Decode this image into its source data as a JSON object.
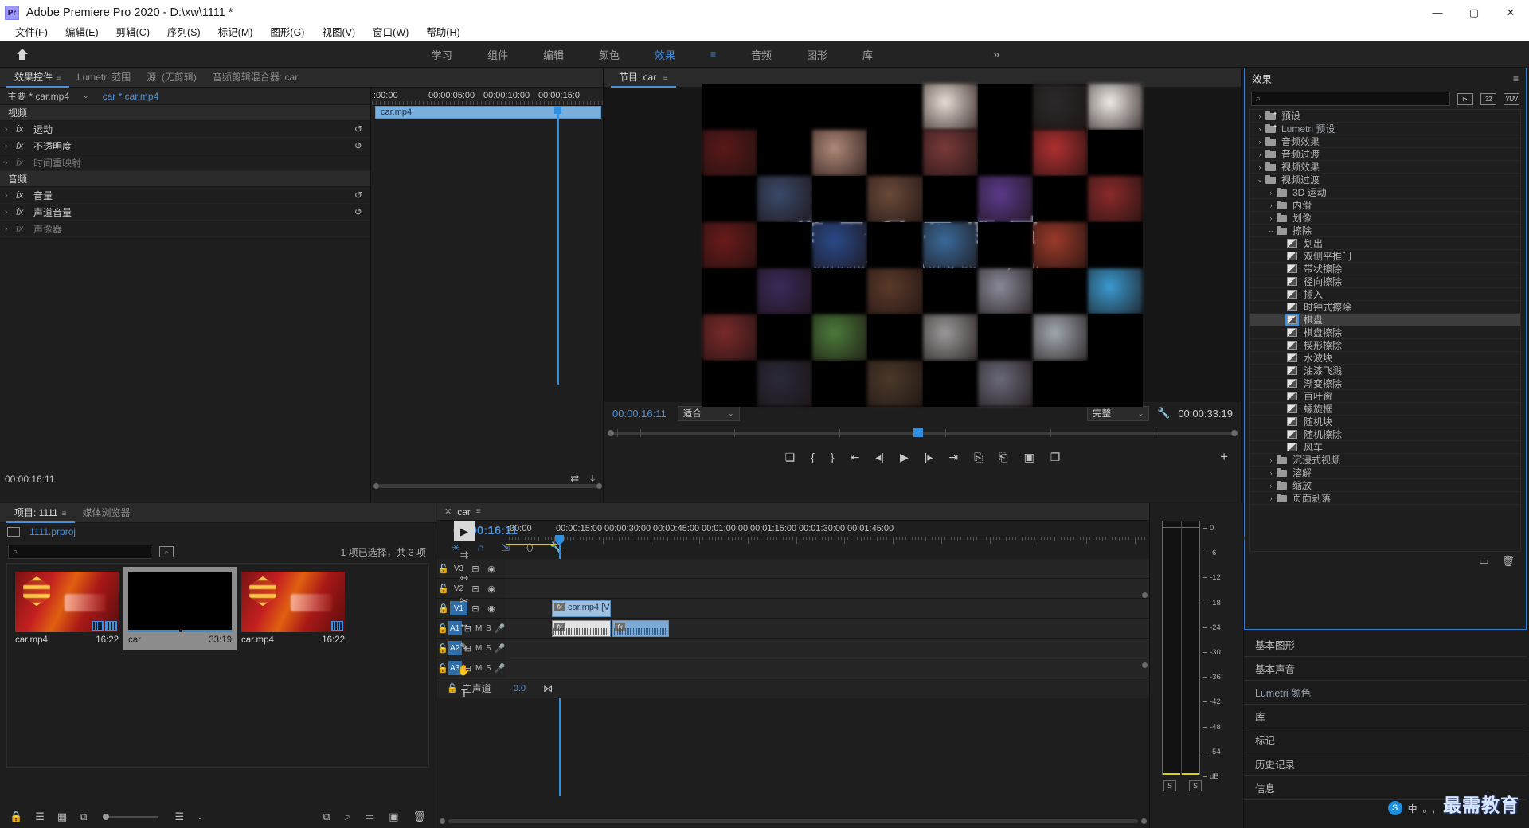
{
  "titlebar": {
    "logo": "Pr",
    "title": "Adobe Premiere Pro 2020 - D:\\xw\\1111 *",
    "minimize": "—",
    "maximize": "▢",
    "close": "✕"
  },
  "menubar": {
    "items": [
      "文件(F)",
      "编辑(E)",
      "剪辑(C)",
      "序列(S)",
      "标记(M)",
      "图形(G)",
      "视图(V)",
      "窗口(W)",
      "帮助(H)"
    ]
  },
  "workspace": {
    "home_icon": "home-icon",
    "items": [
      {
        "label": "学习",
        "active": false
      },
      {
        "label": "组件",
        "active": false
      },
      {
        "label": "编辑",
        "active": false
      },
      {
        "label": "颜色",
        "active": false
      },
      {
        "label": "效果",
        "active": true
      },
      {
        "label": "音频",
        "active": false
      },
      {
        "label": "图形",
        "active": false
      },
      {
        "label": "库",
        "active": false
      }
    ],
    "overflow": "»"
  },
  "effect_controls": {
    "tabs": [
      {
        "label": "效果控件",
        "active": true,
        "menu": "≡"
      },
      {
        "label": "Lumetri 范围",
        "active": false
      },
      {
        "label": "源: (无剪辑)",
        "active": false
      },
      {
        "label": "音频剪辑混合器: car",
        "active": false
      }
    ],
    "clip_bar": {
      "main": "主要 * car.mp4",
      "caret": "⌄",
      "sequence": "car * car.mp4"
    },
    "groups": [
      {
        "title": "视频",
        "rows": [
          {
            "arrow": "›",
            "fx": "fx",
            "name": "运动",
            "dim": false,
            "reset": "↺"
          },
          {
            "arrow": "›",
            "fx": "fx",
            "name": "不透明度",
            "dim": false,
            "reset": "↺"
          },
          {
            "arrow": "›",
            "fx": "fx",
            "name": "时间重映射",
            "dim": true,
            "reset": ""
          }
        ]
      },
      {
        "title": "音频",
        "rows": [
          {
            "arrow": "›",
            "fx": "fx",
            "name": "音量",
            "dim": false,
            "reset": "↺"
          },
          {
            "arrow": "›",
            "fx": "fx",
            "name": "声道音量",
            "dim": false,
            "reset": "↺"
          },
          {
            "arrow": "›",
            "fx": "fx",
            "name": "声像器",
            "dim": true,
            "reset": ""
          }
        ]
      }
    ],
    "ruler_labels": [
      ":00:00",
      "00:00:05:00",
      "00:00:10:00",
      "00:00:15:0"
    ],
    "clip_band_label": "car.mp4",
    "timecode": "00:00:16:11",
    "footer_icons": [
      "loop-icon",
      "export-icon"
    ]
  },
  "program_monitor": {
    "tab_label": "节目: car",
    "tab_menu": "≡",
    "overlay_title": "世界名车鉴赏",
    "overlay_sub": "Appreciation of world century car",
    "current_timecode": "00:00:16:11",
    "fit_select": "适合",
    "quality_select": "完整",
    "wrench_icon": "wrench-icon",
    "duration": "00:00:33:19",
    "transport": [
      {
        "name": "export-frame-marker-icon",
        "glyph": "❏"
      },
      {
        "name": "mark-in-icon",
        "glyph": "{"
      },
      {
        "name": "mark-out-icon",
        "glyph": "}"
      },
      {
        "name": "go-to-in-icon",
        "glyph": "⇤"
      },
      {
        "name": "step-back-icon",
        "glyph": "◂|"
      },
      {
        "name": "play-icon",
        "glyph": "▶"
      },
      {
        "name": "step-forward-icon",
        "glyph": "|▸"
      },
      {
        "name": "go-to-out-icon",
        "glyph": "⇥"
      },
      {
        "name": "lift-icon",
        "glyph": "⎘"
      },
      {
        "name": "extract-icon",
        "glyph": "⎗"
      },
      {
        "name": "export-frame-icon",
        "glyph": "▣"
      },
      {
        "name": "comparison-view-icon",
        "glyph": "❐"
      }
    ],
    "add_button": "+"
  },
  "effects_panel": {
    "title": "效果",
    "menu": "≡",
    "search_placeholder": "",
    "search_value": "",
    "badges": [
      "accelerated-effect-badge",
      "32-bit-color-badge",
      "yuv-badge"
    ],
    "badge_labels": [
      "⊳",
      "32",
      "YUV"
    ],
    "tree": [
      {
        "depth": 0,
        "twirl": "›",
        "icon": "preset-folder",
        "label": "预设",
        "selected": false
      },
      {
        "depth": 0,
        "twirl": "›",
        "icon": "preset-folder",
        "label": "Lumetri 预设",
        "selected": false,
        "lum": true
      },
      {
        "depth": 0,
        "twirl": "›",
        "icon": "folder",
        "label": "音频效果",
        "selected": false
      },
      {
        "depth": 0,
        "twirl": "›",
        "icon": "folder",
        "label": "音频过渡",
        "selected": false
      },
      {
        "depth": 0,
        "twirl": "›",
        "icon": "folder",
        "label": "视频效果",
        "selected": false
      },
      {
        "depth": 0,
        "twirl": "⌄",
        "icon": "folder",
        "label": "视频过渡",
        "selected": false
      },
      {
        "depth": 1,
        "twirl": "›",
        "icon": "folder",
        "label": "3D 运动",
        "selected": false
      },
      {
        "depth": 1,
        "twirl": "›",
        "icon": "folder",
        "label": "内滑",
        "selected": false
      },
      {
        "depth": 1,
        "twirl": "›",
        "icon": "folder",
        "label": "划像",
        "selected": false
      },
      {
        "depth": 1,
        "twirl": "⌄",
        "icon": "folder",
        "label": "擦除",
        "selected": false
      },
      {
        "depth": 2,
        "twirl": "",
        "icon": "wipe",
        "label": "划出",
        "selected": false
      },
      {
        "depth": 2,
        "twirl": "",
        "icon": "wipe",
        "label": "双侧平推门",
        "selected": false
      },
      {
        "depth": 2,
        "twirl": "",
        "icon": "wipe",
        "label": "带状擦除",
        "selected": false
      },
      {
        "depth": 2,
        "twirl": "",
        "icon": "wipe",
        "label": "径向擦除",
        "selected": false
      },
      {
        "depth": 2,
        "twirl": "",
        "icon": "wipe",
        "label": "插入",
        "selected": false
      },
      {
        "depth": 2,
        "twirl": "",
        "icon": "wipe",
        "label": "时钟式擦除",
        "selected": false
      },
      {
        "depth": 2,
        "twirl": "",
        "icon": "wipe",
        "label": "棋盘",
        "selected": true
      },
      {
        "depth": 2,
        "twirl": "",
        "icon": "wipe",
        "label": "棋盘擦除",
        "selected": false
      },
      {
        "depth": 2,
        "twirl": "",
        "icon": "wipe",
        "label": "楔形擦除",
        "selected": false
      },
      {
        "depth": 2,
        "twirl": "",
        "icon": "wipe",
        "label": "水波块",
        "selected": false
      },
      {
        "depth": 2,
        "twirl": "",
        "icon": "wipe",
        "label": "油漆飞溅",
        "selected": false
      },
      {
        "depth": 2,
        "twirl": "",
        "icon": "wipe",
        "label": "渐变擦除",
        "selected": false
      },
      {
        "depth": 2,
        "twirl": "",
        "icon": "wipe",
        "label": "百叶窗",
        "selected": false
      },
      {
        "depth": 2,
        "twirl": "",
        "icon": "wipe",
        "label": "螺旋框",
        "selected": false
      },
      {
        "depth": 2,
        "twirl": "",
        "icon": "wipe",
        "label": "随机块",
        "selected": false
      },
      {
        "depth": 2,
        "twirl": "",
        "icon": "wipe",
        "label": "随机擦除",
        "selected": false
      },
      {
        "depth": 2,
        "twirl": "",
        "icon": "wipe",
        "label": "风车",
        "selected": false
      },
      {
        "depth": 1,
        "twirl": "›",
        "icon": "folder",
        "label": "沉浸式视频",
        "selected": false
      },
      {
        "depth": 1,
        "twirl": "›",
        "icon": "folder",
        "label": "溶解",
        "selected": false
      },
      {
        "depth": 1,
        "twirl": "›",
        "icon": "folder",
        "label": "缩放",
        "selected": false
      },
      {
        "depth": 1,
        "twirl": "›",
        "icon": "folder",
        "label": "页面剥落",
        "selected": false
      }
    ],
    "footer_icons": [
      "new-custom-bin-icon",
      "delete-custom-item-icon"
    ],
    "footer_glyphs": [
      "▭",
      "🗑"
    ]
  },
  "stacked_panels": {
    "rows": [
      {
        "label": "基本图形",
        "lum": false
      },
      {
        "label": "基本声音",
        "lum": false
      },
      {
        "label": "Lumetri 颜色",
        "lum": true
      },
      {
        "label": "库",
        "lum": false
      },
      {
        "label": "标记",
        "lum": false
      },
      {
        "label": "历史记录",
        "lum": false
      },
      {
        "label": "信息",
        "lum": false
      }
    ]
  },
  "project_panel": {
    "tabs": [
      {
        "label": "项目: 1111",
        "active": true,
        "menu": "≡"
      },
      {
        "label": "媒体浏览器",
        "active": false
      }
    ],
    "breadcrumb": "1111.prproj",
    "search_placeholder": "",
    "search_value": "",
    "find_icon": "find-icon",
    "status": "1 项已选择，共 3 项",
    "items": [
      {
        "name": "car.mp4",
        "duration": "16:22",
        "selected": false,
        "type": "video",
        "badges": [
          "film-badge",
          "audio-badge"
        ]
      },
      {
        "name": "car",
        "duration": "33:19",
        "selected": true,
        "type": "sequence",
        "badges": []
      },
      {
        "name": "car.mp4",
        "duration": "16:22",
        "selected": false,
        "type": "video",
        "badges": [
          "audio-badge"
        ]
      }
    ],
    "toolbar": [
      {
        "name": "lock-icon",
        "glyph": "🔒"
      },
      {
        "name": "list-view-icon",
        "glyph": "☰"
      },
      {
        "name": "icon-view-icon",
        "glyph": "▦"
      },
      {
        "name": "freeform-view-icon",
        "glyph": "⧉"
      },
      {
        "name": "zoom-slider",
        "glyph": ""
      },
      {
        "name": "sort-icon",
        "glyph": "≡"
      },
      {
        "name": "sort-caret-icon",
        "glyph": "⌄"
      }
    ],
    "toolbar_right": [
      {
        "name": "automate-to-sequence-icon",
        "glyph": "⧉"
      },
      {
        "name": "find-icon",
        "glyph": "⌕"
      },
      {
        "name": "new-bin-icon",
        "glyph": "▭"
      },
      {
        "name": "new-item-icon",
        "glyph": "▣"
      },
      {
        "name": "clear-icon",
        "glyph": "🗑"
      }
    ]
  },
  "timeline": {
    "tab": {
      "close": "✕",
      "label": "car",
      "menu": "≡"
    },
    "timecode": "00:00:16:11",
    "header_icons": [
      {
        "name": "nest-sequence-icon",
        "glyph": "✳",
        "accent": true
      },
      {
        "name": "snap-icon",
        "glyph": "∩",
        "accent": true
      },
      {
        "name": "linked-selection-icon",
        "glyph": "⇲",
        "accent": true
      },
      {
        "name": "add-marker-icon",
        "glyph": "⬯",
        "accent": false
      },
      {
        "name": "timeline-settings-icon",
        "glyph": "🔧",
        "accent": false
      }
    ],
    "ruler_labels": [
      ":00:00",
      "00:00:15:00",
      "00:00:30:00",
      "00:00:45:00",
      "00:01:00:00",
      "00:01:15:00",
      "00:01:30:00",
      "00:01:45:00"
    ],
    "tracks": [
      {
        "id": "V3",
        "kind": "video",
        "targeted": false,
        "lock": "🔓",
        "sync": "⊟",
        "eye": "◉"
      },
      {
        "id": "V2",
        "kind": "video",
        "targeted": false,
        "lock": "🔓",
        "sync": "⊟",
        "eye": "◉"
      },
      {
        "id": "V1",
        "kind": "video",
        "targeted": true,
        "lock": "🔓",
        "sync": "⊟",
        "eye": "◉"
      },
      {
        "id": "A1",
        "kind": "audio",
        "targeted": true,
        "lock": "🔓",
        "sync": "⊟",
        "m": "M",
        "s": "S",
        "mic": "🎤"
      },
      {
        "id": "A2",
        "kind": "audio",
        "targeted": true,
        "lock": "🔓",
        "sync": "⊟",
        "m": "M",
        "s": "S",
        "mic": "🎤"
      },
      {
        "id": "A3",
        "kind": "audio",
        "targeted": true,
        "lock": "🔓",
        "sync": "⊟",
        "m": "M",
        "s": "S",
        "mic": "🎤"
      }
    ],
    "master": {
      "lock": "🔓",
      "label": "主声道",
      "value": "0.0",
      "icon": "⋈"
    },
    "clips": [
      {
        "track": "V1",
        "label": "car.mp4 [V",
        "fx": "fx",
        "style": "video"
      },
      {
        "track": "A1",
        "label": "",
        "fx": "fx",
        "style": "audio-sel"
      },
      {
        "track": "A1",
        "label": "",
        "fx": "fx",
        "style": "audio-b"
      }
    ]
  },
  "tools": [
    {
      "name": "selection-tool",
      "glyph": "▶",
      "active": true
    },
    {
      "name": "track-select-forward-tool",
      "glyph": "⇉",
      "active": false
    },
    {
      "name": "ripple-edit-tool",
      "glyph": "⇿",
      "active": false
    },
    {
      "name": "razor-tool",
      "glyph": "✂",
      "active": false
    },
    {
      "name": "slip-tool",
      "glyph": "↔",
      "active": false
    },
    {
      "name": "pen-tool",
      "glyph": "✎",
      "active": false
    },
    {
      "name": "hand-tool",
      "glyph": "✋",
      "active": false
    },
    {
      "name": "type-tool",
      "glyph": "T",
      "active": false
    }
  ],
  "audio_meters": {
    "scale": [
      "0",
      "-6",
      "-12",
      "-18",
      "-24",
      "-30",
      "-36",
      "-42",
      "-48",
      "-54",
      "dB"
    ],
    "solo_buttons": [
      "S",
      "S"
    ]
  },
  "watermark": {
    "text": "最需教育",
    "tray_text": "中",
    "tray_sep": "。,",
    "tray_icon": "ime-icon"
  },
  "colors": {
    "accent_blue": "#4e93dd",
    "playhead_blue": "#2f8fe0",
    "panel_bg": "#1e1e1e",
    "track_target": "#2f6ea8",
    "work_area_yellow": "#d8d20e"
  }
}
